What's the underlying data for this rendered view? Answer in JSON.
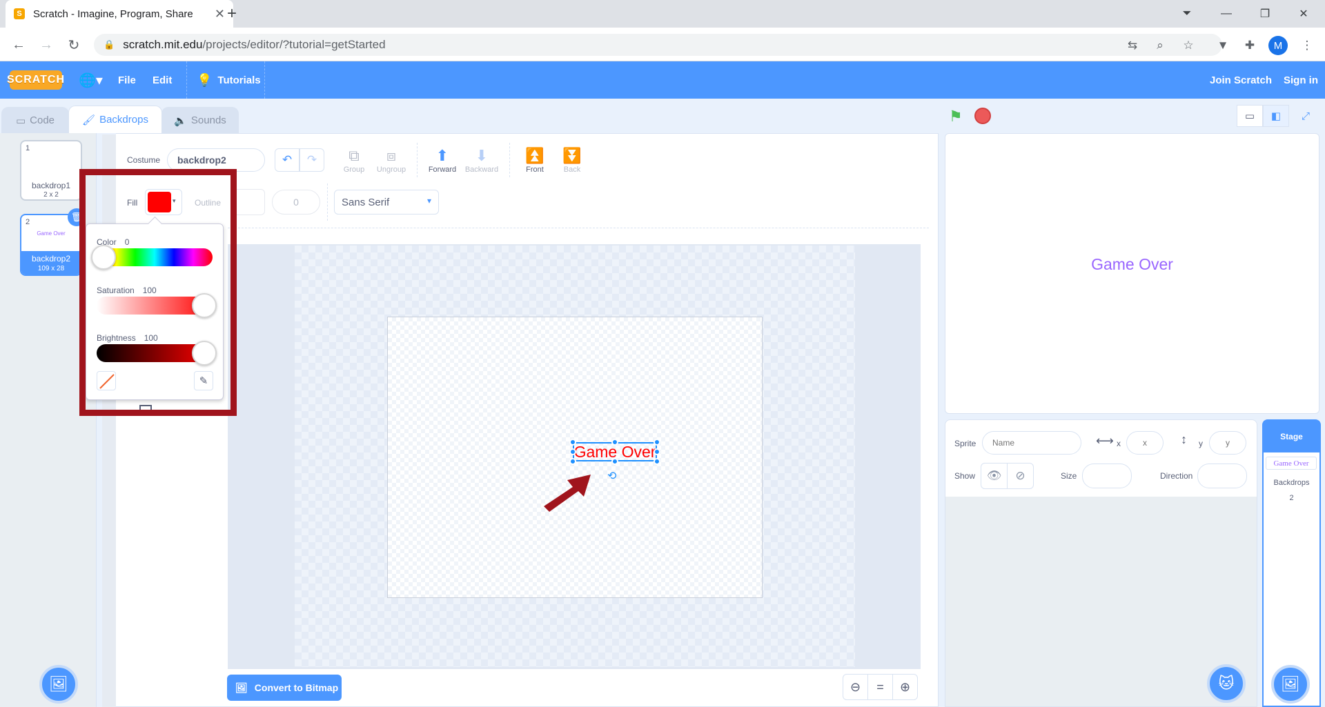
{
  "browser": {
    "tab_title": "Scratch - Imagine, Program, Share",
    "url_host": "scratch.mit.edu",
    "url_path": "/projects/editor/?tutorial=getStarted",
    "avatar_letter": "M",
    "icons": [
      "back-icon",
      "forward-icon",
      "reload-icon",
      "lock-icon",
      "translate-icon",
      "zoom-icon",
      "star-icon",
      "extension-icon",
      "puzzle-icon"
    ]
  },
  "menu": {
    "logo": "SCRATCH",
    "file": "File",
    "edit": "Edit",
    "tutorials": "Tutorials",
    "join": "Join Scratch",
    "signin": "Sign in"
  },
  "tabs": {
    "code": "Code",
    "backdrops": "Backdrops",
    "sounds": "Sounds"
  },
  "costumes": [
    {
      "num": "1",
      "name": "backdrop1",
      "size": "2 x 2",
      "preview": ""
    },
    {
      "num": "2",
      "name": "backdrop2",
      "size": "109 x 28",
      "preview": "Game Over"
    }
  ],
  "paint": {
    "costume_label": "Costume",
    "costume_name": "backdrop2",
    "group": "Group",
    "ungroup": "Ungroup",
    "forward": "Forward",
    "backward": "Backward",
    "front": "Front",
    "back": "Back",
    "fill_label": "Fill",
    "fill_color": "#ff0000",
    "outline_label": "Outline",
    "outline_width": "0",
    "font": "Sans Serif",
    "canvas_text": "Game Over",
    "convert": "Convert to Bitmap"
  },
  "color_picker": {
    "color_label": "Color",
    "color_value": "0",
    "saturation_label": "Saturation",
    "saturation_value": "100",
    "brightness_label": "Brightness",
    "brightness_value": "100",
    "hue_level": 0,
    "saturation_level": 1,
    "brightness_level": 1
  },
  "stage": {
    "text": "Game Over",
    "text_color": "#9966ff"
  },
  "sprite_info": {
    "sprite_label": "Sprite",
    "name_placeholder": "Name",
    "x_label": "x",
    "x_placeholder": "x",
    "y_label": "y",
    "y_placeholder": "y",
    "show_label": "Show",
    "size_label": "Size",
    "direction_label": "Direction"
  },
  "stage_panel": {
    "title": "Stage",
    "thumb_text": "Game Over",
    "backdrops_label": "Backdrops",
    "backdrops_count": "2"
  },
  "colors": {
    "accent": "#4c97ff",
    "highlight": "#a0141c"
  }
}
